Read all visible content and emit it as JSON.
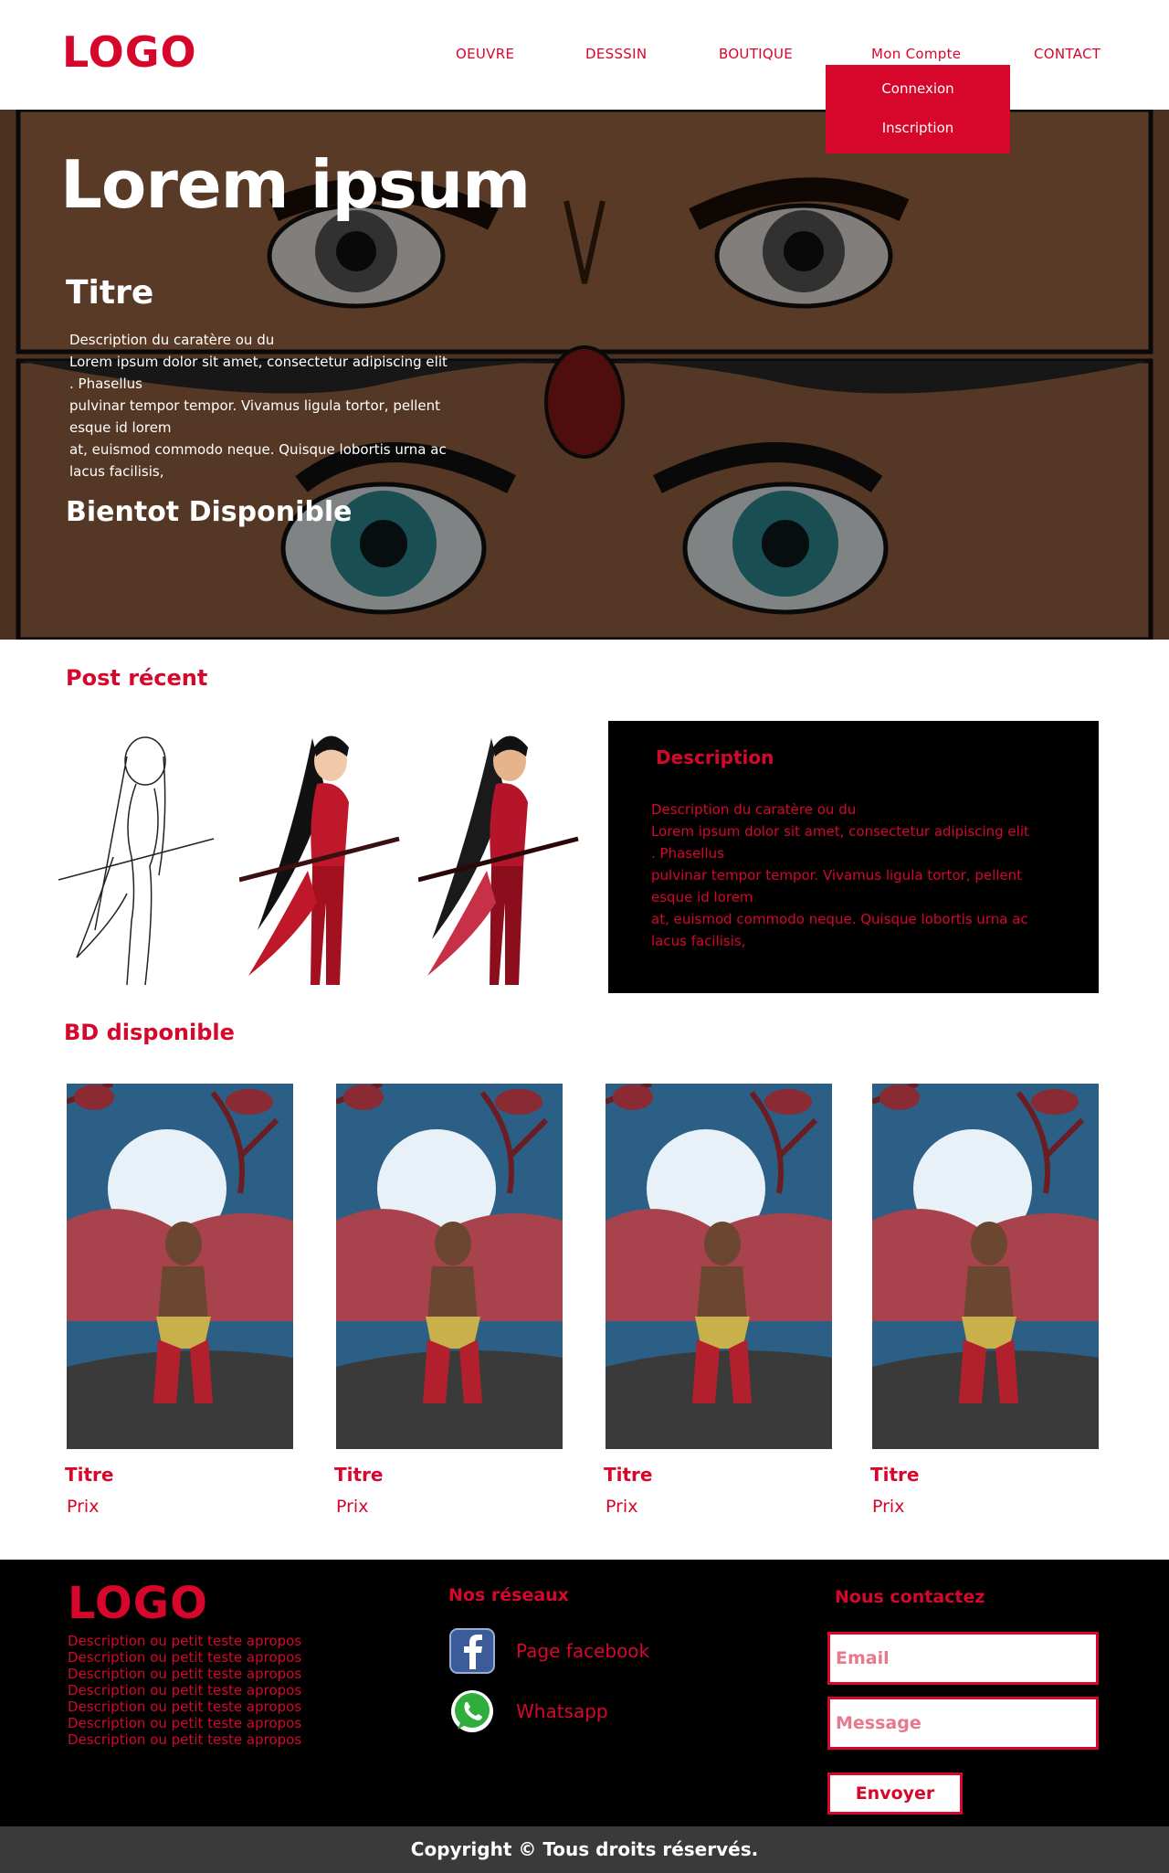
{
  "header": {
    "logo": "LOGO",
    "nav": [
      "OEUVRE",
      "DESSSIN",
      "BOUTIQUE",
      "Mon Compte",
      "CONTACT"
    ],
    "account_menu": [
      "Connexion",
      "Inscription"
    ]
  },
  "hero": {
    "title": "Lorem ipsum",
    "subtitle": "Titre",
    "description": "Description du caratère ou du\nLorem ipsum dolor sit amet, consectetur adipiscing elit\n. Phasellus\n pulvinar tempor tempor. Vivamus ligula tortor, pellent\nesque id lorem\n at, euismod commodo neque. Quisque lobortis urna ac\nlacus facilisis,",
    "coming_soon": "Bientot Disponible"
  },
  "recent_post": {
    "heading": "Post récent",
    "description_title": "Description",
    "description_text": "Description du caratère ou du\nLorem ipsum dolor sit amet, consectetur adipiscing elit\n. Phasellus\n pulvinar tempor tempor. Vivamus ligula tortor, pellent\nesque id lorem\n at, euismod commodo neque. Quisque lobortis urna ac\nlacus facilisis,"
  },
  "comics": {
    "heading": "BD disponible",
    "items": [
      {
        "title": "Titre",
        "price": "Prix"
      },
      {
        "title": "Titre",
        "price": "Prix"
      },
      {
        "title": "Titre",
        "price": "Prix"
      },
      {
        "title": "Titre",
        "price": "Prix"
      }
    ]
  },
  "footer": {
    "logo": "LOGO",
    "description_lines": [
      "Description ou petit teste apropos",
      "Description ou petit teste apropos",
      "Description ou petit teste apropos",
      "Description ou petit teste apropos",
      "Description ou petit teste apropos",
      "Description ou petit teste apropos",
      "Description ou petit teste apropos"
    ],
    "social_heading": "Nos réseaux",
    "facebook_label": "Page facebook",
    "whatsapp_label": "Whatsapp",
    "contact_heading": "Nous contactez",
    "email_placeholder": "Email",
    "message_placeholder": "Message",
    "send_label": "Envoyer",
    "copyright": "Copyright © Tous droits réservés."
  },
  "colors": {
    "accent": "#d6072b",
    "footer_bg": "#000000",
    "copyright_bg": "#3a3a3a"
  }
}
